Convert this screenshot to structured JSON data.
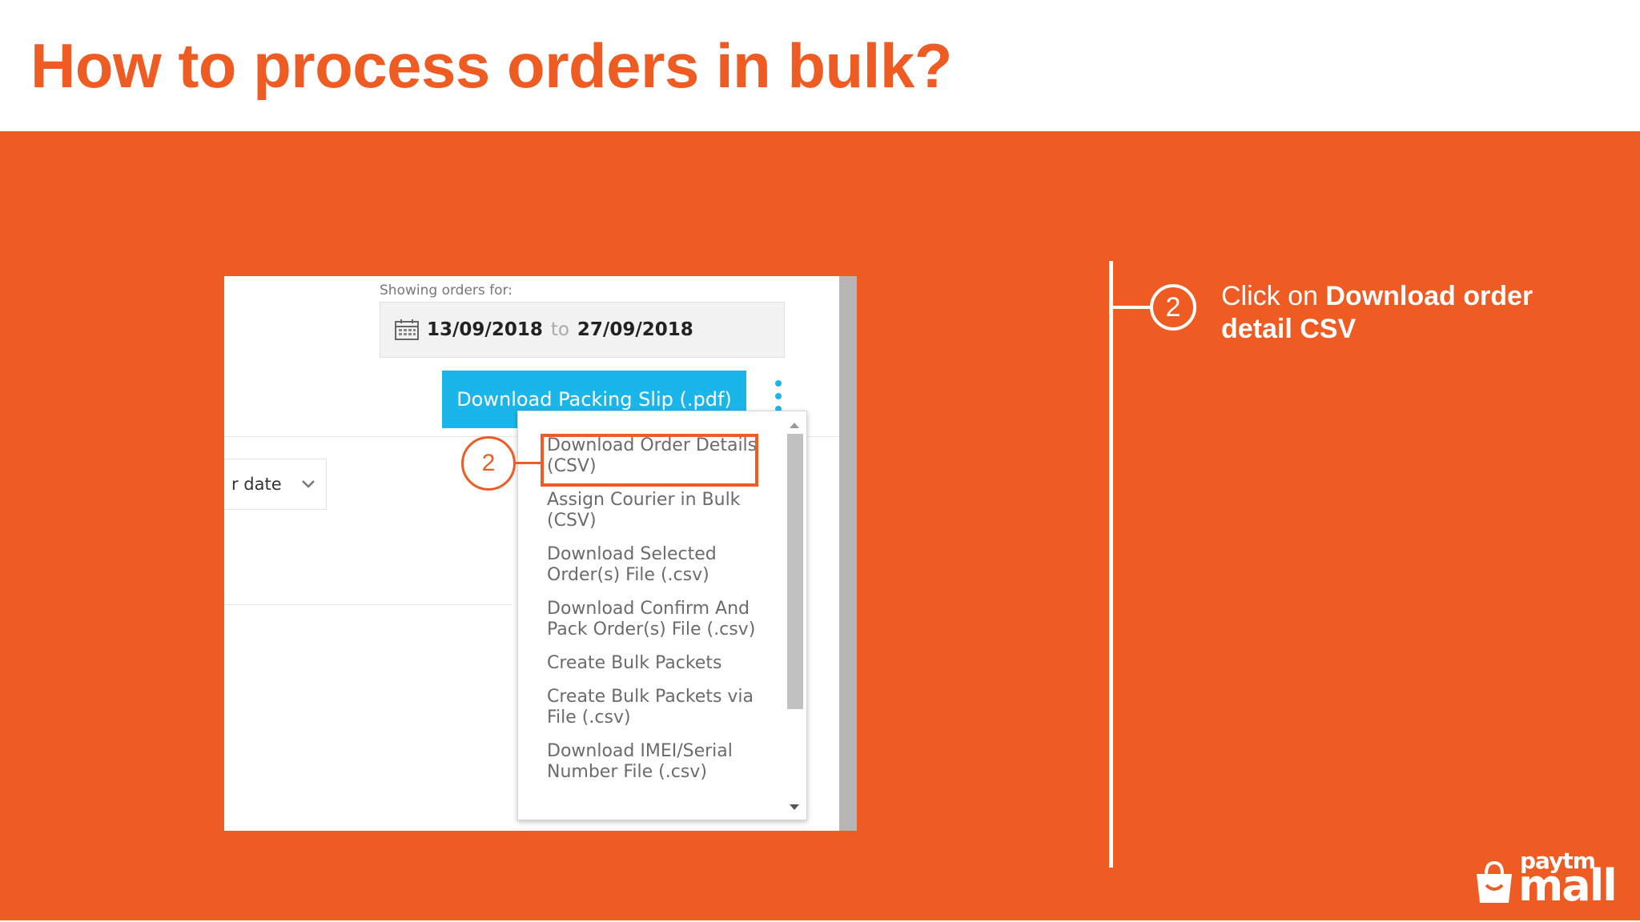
{
  "slide": {
    "title": "How to process orders in bulk?"
  },
  "screenshot": {
    "showing_label": "Showing orders for:",
    "date_from": "13/09/2018",
    "date_to_word": "to",
    "date_to": "27/09/2018",
    "packing_slip_button": "Download Packing Slip (.pdf)",
    "sort_label": "r date",
    "menu_items": [
      "Download Order Details (CSV)",
      "Assign Courier in Bulk (CSV)",
      "Download Selected Order(s) File (.csv)",
      "Download Confirm And Pack Order(s) File (.csv)",
      "Create Bulk Packets",
      "Create Bulk Packets via File (.csv)",
      "Download IMEI/Serial Number File (.csv)"
    ],
    "callout_number": "2"
  },
  "instruction": {
    "step_number": "2",
    "text_prefix": "Click on ",
    "text_bold": "Download order detail CSV"
  },
  "logo": {
    "top": "paytm",
    "bottom": "mall"
  },
  "colors": {
    "accent": "#ee5b23",
    "button": "#1ab6ea"
  },
  "icons": [
    "calendar-icon",
    "chevron-down-icon",
    "kebab-menu-icon",
    "scroll-up-arrow-icon",
    "scroll-down-arrow-icon",
    "shopping-bag-icon"
  ]
}
